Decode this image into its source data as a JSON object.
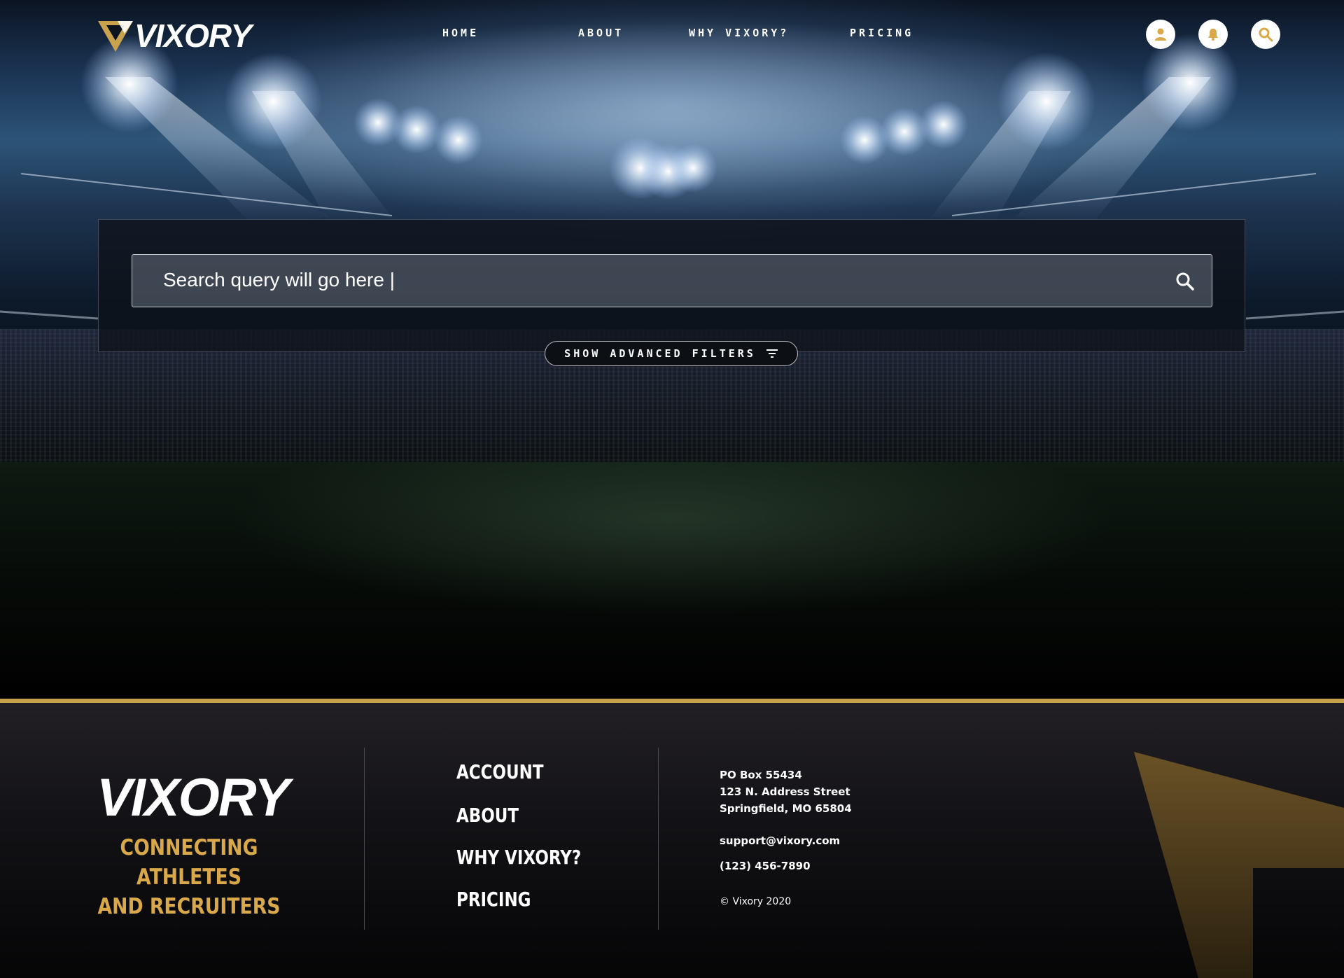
{
  "header": {
    "logo_text": "VIXORY",
    "nav": [
      {
        "label": "HOME"
      },
      {
        "label": "ABOUT"
      },
      {
        "label": "WHY VIXORY?"
      },
      {
        "label": "PRICING"
      }
    ],
    "icons": [
      "user-icon",
      "bell-icon",
      "search-icon"
    ]
  },
  "search": {
    "query": "Search query will go here |",
    "submit_icon": "search-icon",
    "filters_label": "SHOW ADVANCED FILTERS",
    "filters_icon": "filter-icon"
  },
  "footer": {
    "logo_text": "VIXORY",
    "tagline_line1": "CONNECTING ATHLETES",
    "tagline_line2": "AND RECRUITERS",
    "nav": [
      {
        "label": "ACCOUNT"
      },
      {
        "label": "ABOUT"
      },
      {
        "label": "WHY VIXORY?"
      },
      {
        "label": "PRICING"
      }
    ],
    "address_line1": "PO Box 55434",
    "address_line2": "123 N. Address Street",
    "address_line3": "Springfield, MO 65804",
    "email": "support@vixory.com",
    "phone": "(123) 456-7890",
    "copyright": "© Vixory 2020"
  },
  "colors": {
    "accent_gold": "#c9a24e",
    "tagline_gold": "#d9a84a",
    "background": "#000000"
  }
}
